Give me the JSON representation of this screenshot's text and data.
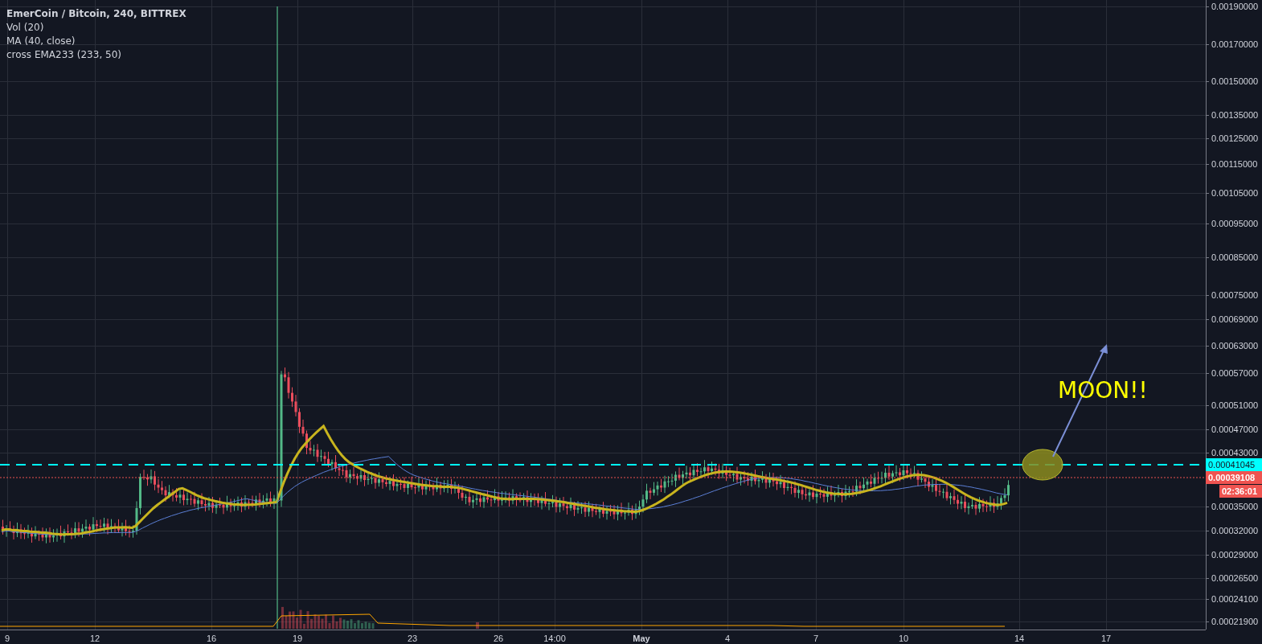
{
  "legend": {
    "title": "EmerCoin / Bitcoin, 240, BITTREX",
    "indicators": [
      "Vol (20)",
      "MA (40, close)",
      "cross EMA233 (233, 50)"
    ]
  },
  "price_axis": {
    "ticks": [
      "0.00190000",
      "0.00170000",
      "0.00150000",
      "0.00135000",
      "0.00125000",
      "0.00115000",
      "0.00105000",
      "0.00095000",
      "0.00085000",
      "0.00075000",
      "0.00069000",
      "0.00063000",
      "0.00057000",
      "0.00051000",
      "0.00047000",
      "0.00043000",
      "0.00035000",
      "0.00032000",
      "0.00029000",
      "0.00026500",
      "0.00024100",
      "0.00021900"
    ]
  },
  "time_axis": {
    "ticks": [
      {
        "label": "9",
        "bold": false
      },
      {
        "label": "12",
        "bold": false
      },
      {
        "label": "16",
        "bold": false
      },
      {
        "label": "19",
        "bold": false
      },
      {
        "label": "23",
        "bold": false
      },
      {
        "label": "26",
        "bold": false
      },
      {
        "label": "14:00",
        "bold": false
      },
      {
        "label": "May",
        "bold": true
      },
      {
        "label": "4",
        "bold": false
      },
      {
        "label": "7",
        "bold": false
      },
      {
        "label": "10",
        "bold": false
      },
      {
        "label": "14",
        "bold": false
      },
      {
        "label": "17",
        "bold": false
      }
    ]
  },
  "price_labels": [
    {
      "kind": "line",
      "text": "0.00041045",
      "color": "#00ffff"
    },
    {
      "kind": "last",
      "text": "0.00039108",
      "color": "#ef5350"
    },
    {
      "kind": "countdown",
      "text": "02:36:01",
      "color": "#ef5350"
    }
  ],
  "annotation": {
    "text": "MOON!!"
  }
}
